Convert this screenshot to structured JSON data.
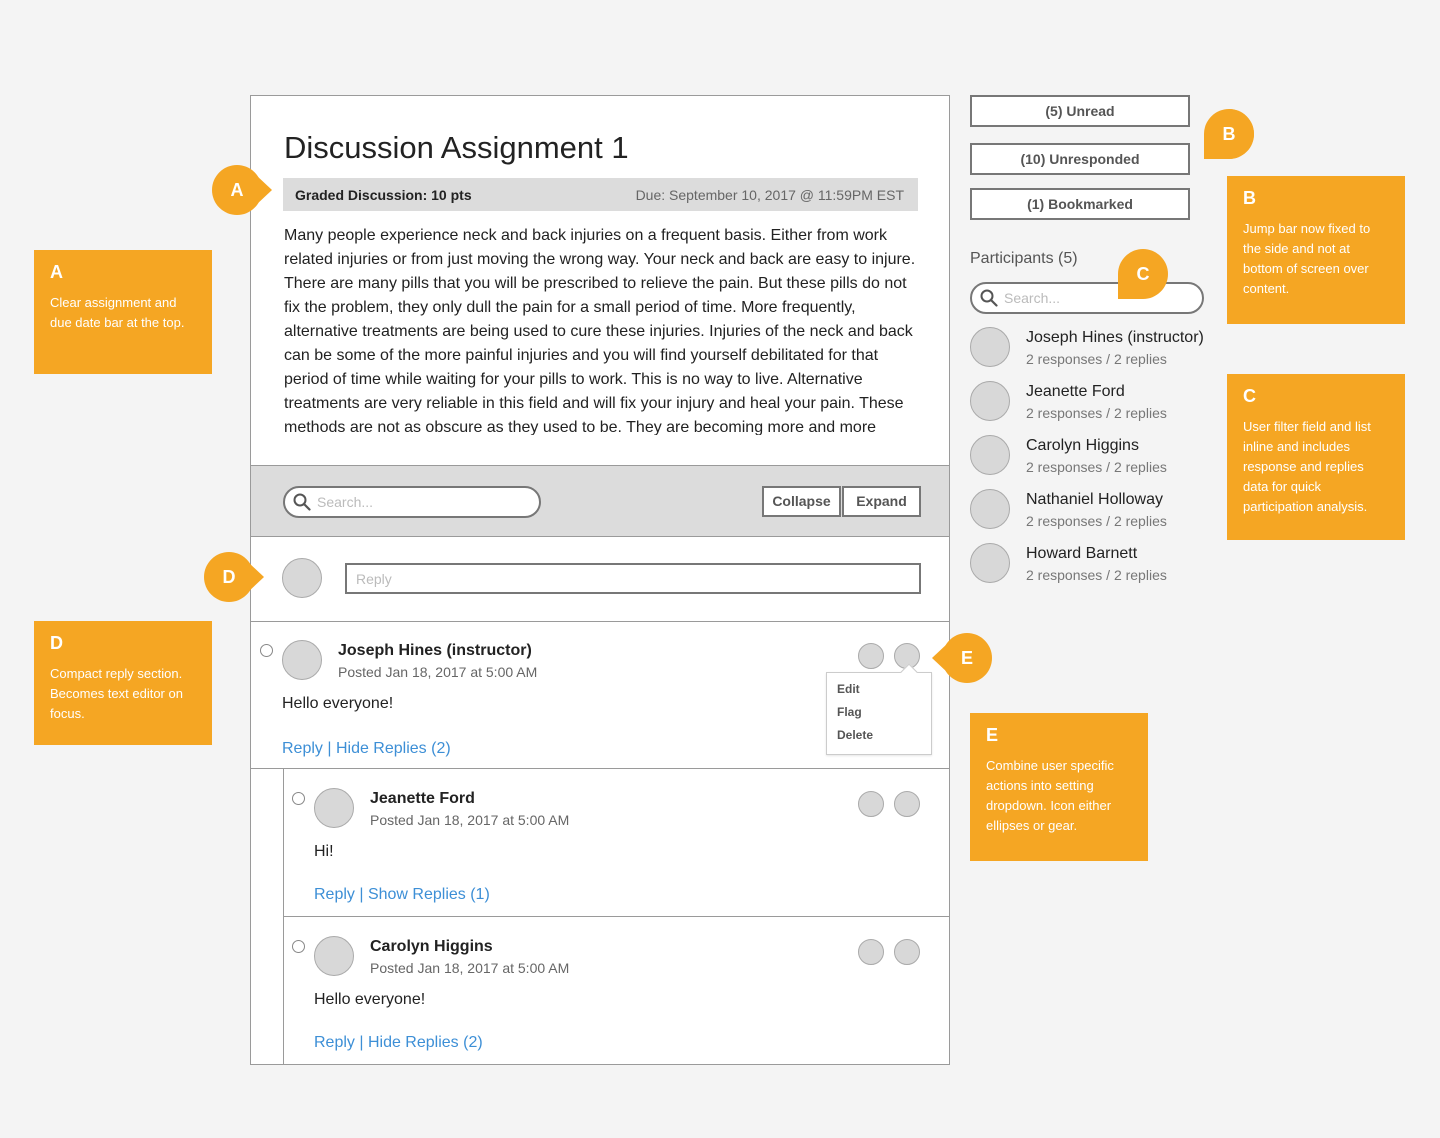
{
  "assignment": {
    "title": "Discussion Assignment 1",
    "graded_label": "Graded Discussion: 10 pts",
    "due": "Due: September 10, 2017 @ 11:59PM EST",
    "body": "Many people experience neck and back injuries on a frequent basis. Either from work related injuries or from just moving the wrong way. Your neck and back are easy to injure. There are many pills that you will be prescribed to relieve the pain. But these pills do not fix the problem, they only dull the pain for a small period of time. More frequently, alternative treatments are being used to cure these injuries. Injuries of the neck and back can be some of the more painful injuries and you will find yourself debilitated for that period of time while waiting for your pills to work. This is no way to live. Alternative treatments are very reliable in this field and will fix your injury and heal your pain. These methods are not as obscure as they used to be. They are becoming more and more"
  },
  "toolbar": {
    "search_placeholder": "Search...",
    "collapse_label": "Collapse",
    "expand_label": "Expand"
  },
  "reply_box": {
    "placeholder": "Reply"
  },
  "posts": [
    {
      "author": "Joseph Hines (instructor)",
      "posted": "Posted Jan 18, 2017 at 5:00 AM",
      "body": "Hello everyone!",
      "reply": "Reply",
      "sep": " | ",
      "toggle": "Hide Replies (2)"
    },
    {
      "author": "Jeanette Ford",
      "posted": "Posted Jan 18, 2017 at 5:00 AM",
      "body": "Hi!",
      "reply": "Reply",
      "sep": " | ",
      "toggle": "Show Replies (1)"
    },
    {
      "author": "Carolyn Higgins",
      "posted": "Posted Jan 18, 2017 at 5:00 AM",
      "body": "Hello everyone!",
      "reply": "Reply",
      "sep": " | ",
      "toggle": "Hide Replies (2)"
    }
  ],
  "settings_menu": {
    "items": [
      "Edit",
      "Flag",
      "Delete"
    ]
  },
  "jump_bar": {
    "unread": "(5) Unread",
    "unresponded": "(10) Unresponded",
    "bookmarked": "(1) Bookmarked"
  },
  "participants": {
    "title": "Participants (5)",
    "search_placeholder": "Search...",
    "items": [
      {
        "name": "Joseph Hines (instructor)",
        "stats": "2 responses / 2 replies"
      },
      {
        "name": "Jeanette Ford",
        "stats": "2 responses / 2 replies"
      },
      {
        "name": "Carolyn Higgins",
        "stats": "2 responses / 2 replies"
      },
      {
        "name": "Nathaniel Holloway",
        "stats": "2 responses / 2 replies"
      },
      {
        "name": "Howard Barnett",
        "stats": "2 responses / 2 replies"
      }
    ]
  },
  "annotations": {
    "a": {
      "letter": "A",
      "text": "Clear assignment and due date bar at the top."
    },
    "b": {
      "letter": "B",
      "text": "Jump bar now fixed to the side and not at bottom of screen over content."
    },
    "c": {
      "letter": "C",
      "text": "User filter field and list inline and includes response and replies data for quick participation analysis."
    },
    "d": {
      "letter": "D",
      "text": "Compact reply section. Becomes text editor on focus."
    },
    "e": {
      "letter": "E",
      "text": "Combine user specific actions into setting dropdown. Icon either ellipses or gear."
    }
  },
  "colors": {
    "accent": "#f5a623",
    "link": "#3d8fd6"
  }
}
